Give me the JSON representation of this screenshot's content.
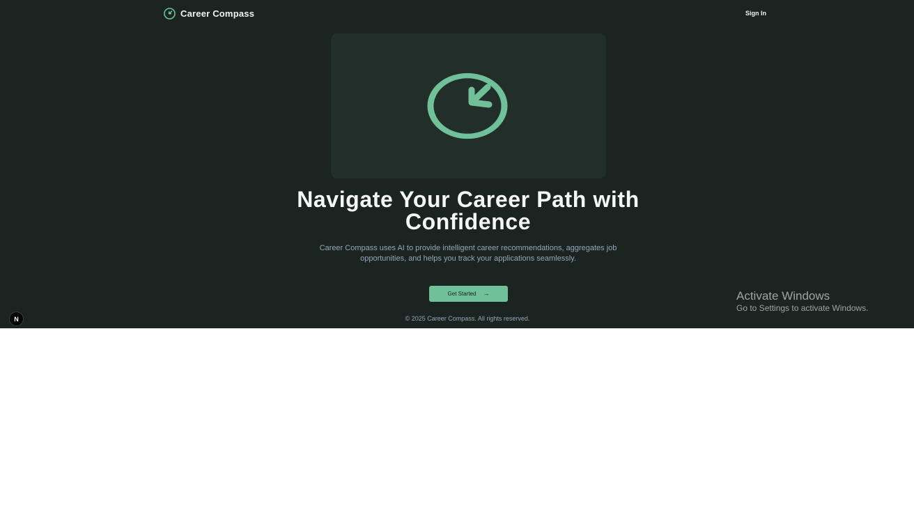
{
  "header": {
    "brand_name": "Career Compass",
    "brand_icon": "compass-icon",
    "sign_in_label": "Sign In"
  },
  "hero": {
    "illustration_icon": "compass-icon",
    "title": "Navigate Your Career Path with Confidence",
    "subtitle": "Career Compass uses AI to provide intelligent career recommendations, aggregates job opportunities, and helps you track your applications seamlessly.",
    "cta_label": "Get Started",
    "cta_icon": "arrow-right-icon"
  },
  "footer": {
    "copyright": "© 2025 Career Compass. All rights reserved."
  },
  "os_overlay": {
    "title": "Activate Windows",
    "subtitle": "Go to Settings to activate Windows."
  },
  "dev_badge": {
    "letter": "N",
    "icon": "nextjs-icon"
  },
  "colors": {
    "background": "#1c2422",
    "card": "#222e2a",
    "accent": "#70c09a",
    "text": "#f1f5f3",
    "muted": "#94a7b8"
  }
}
